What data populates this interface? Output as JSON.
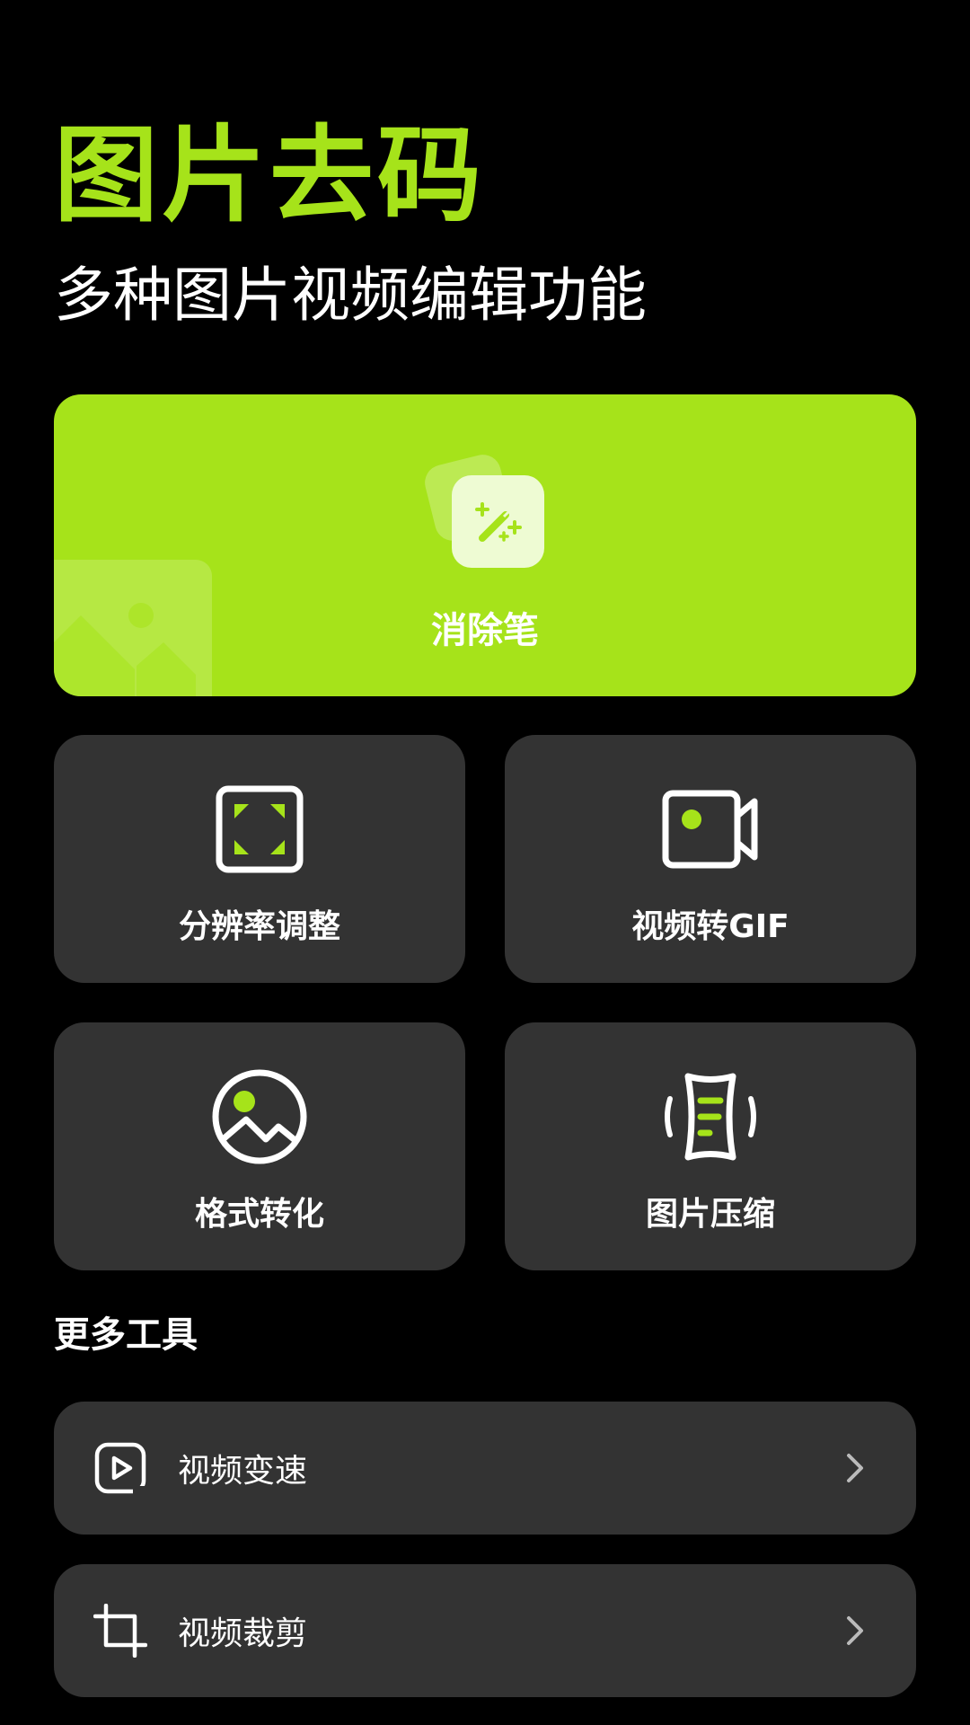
{
  "header": {
    "title": "图片去码",
    "subtitle": "多种图片视频编辑功能"
  },
  "hero": {
    "label": "消除笔",
    "icon": "magic-wand-icon"
  },
  "tiles": [
    {
      "label": "分辨率调整",
      "icon": "resolution-frame-icon"
    },
    {
      "label": "视频转GIF",
      "icon": "video-camera-icon"
    },
    {
      "label": "格式转化",
      "icon": "image-circle-icon"
    },
    {
      "label": "图片压缩",
      "icon": "compress-icon"
    }
  ],
  "more_tools": {
    "title": "更多工具",
    "items": [
      {
        "label": "视频变速",
        "icon": "video-play-icon"
      },
      {
        "label": "视频裁剪",
        "icon": "crop-icon"
      }
    ]
  },
  "colors": {
    "accent": "#a6e31a",
    "background": "#000000",
    "card": "#333333",
    "text": "#ffffff"
  }
}
